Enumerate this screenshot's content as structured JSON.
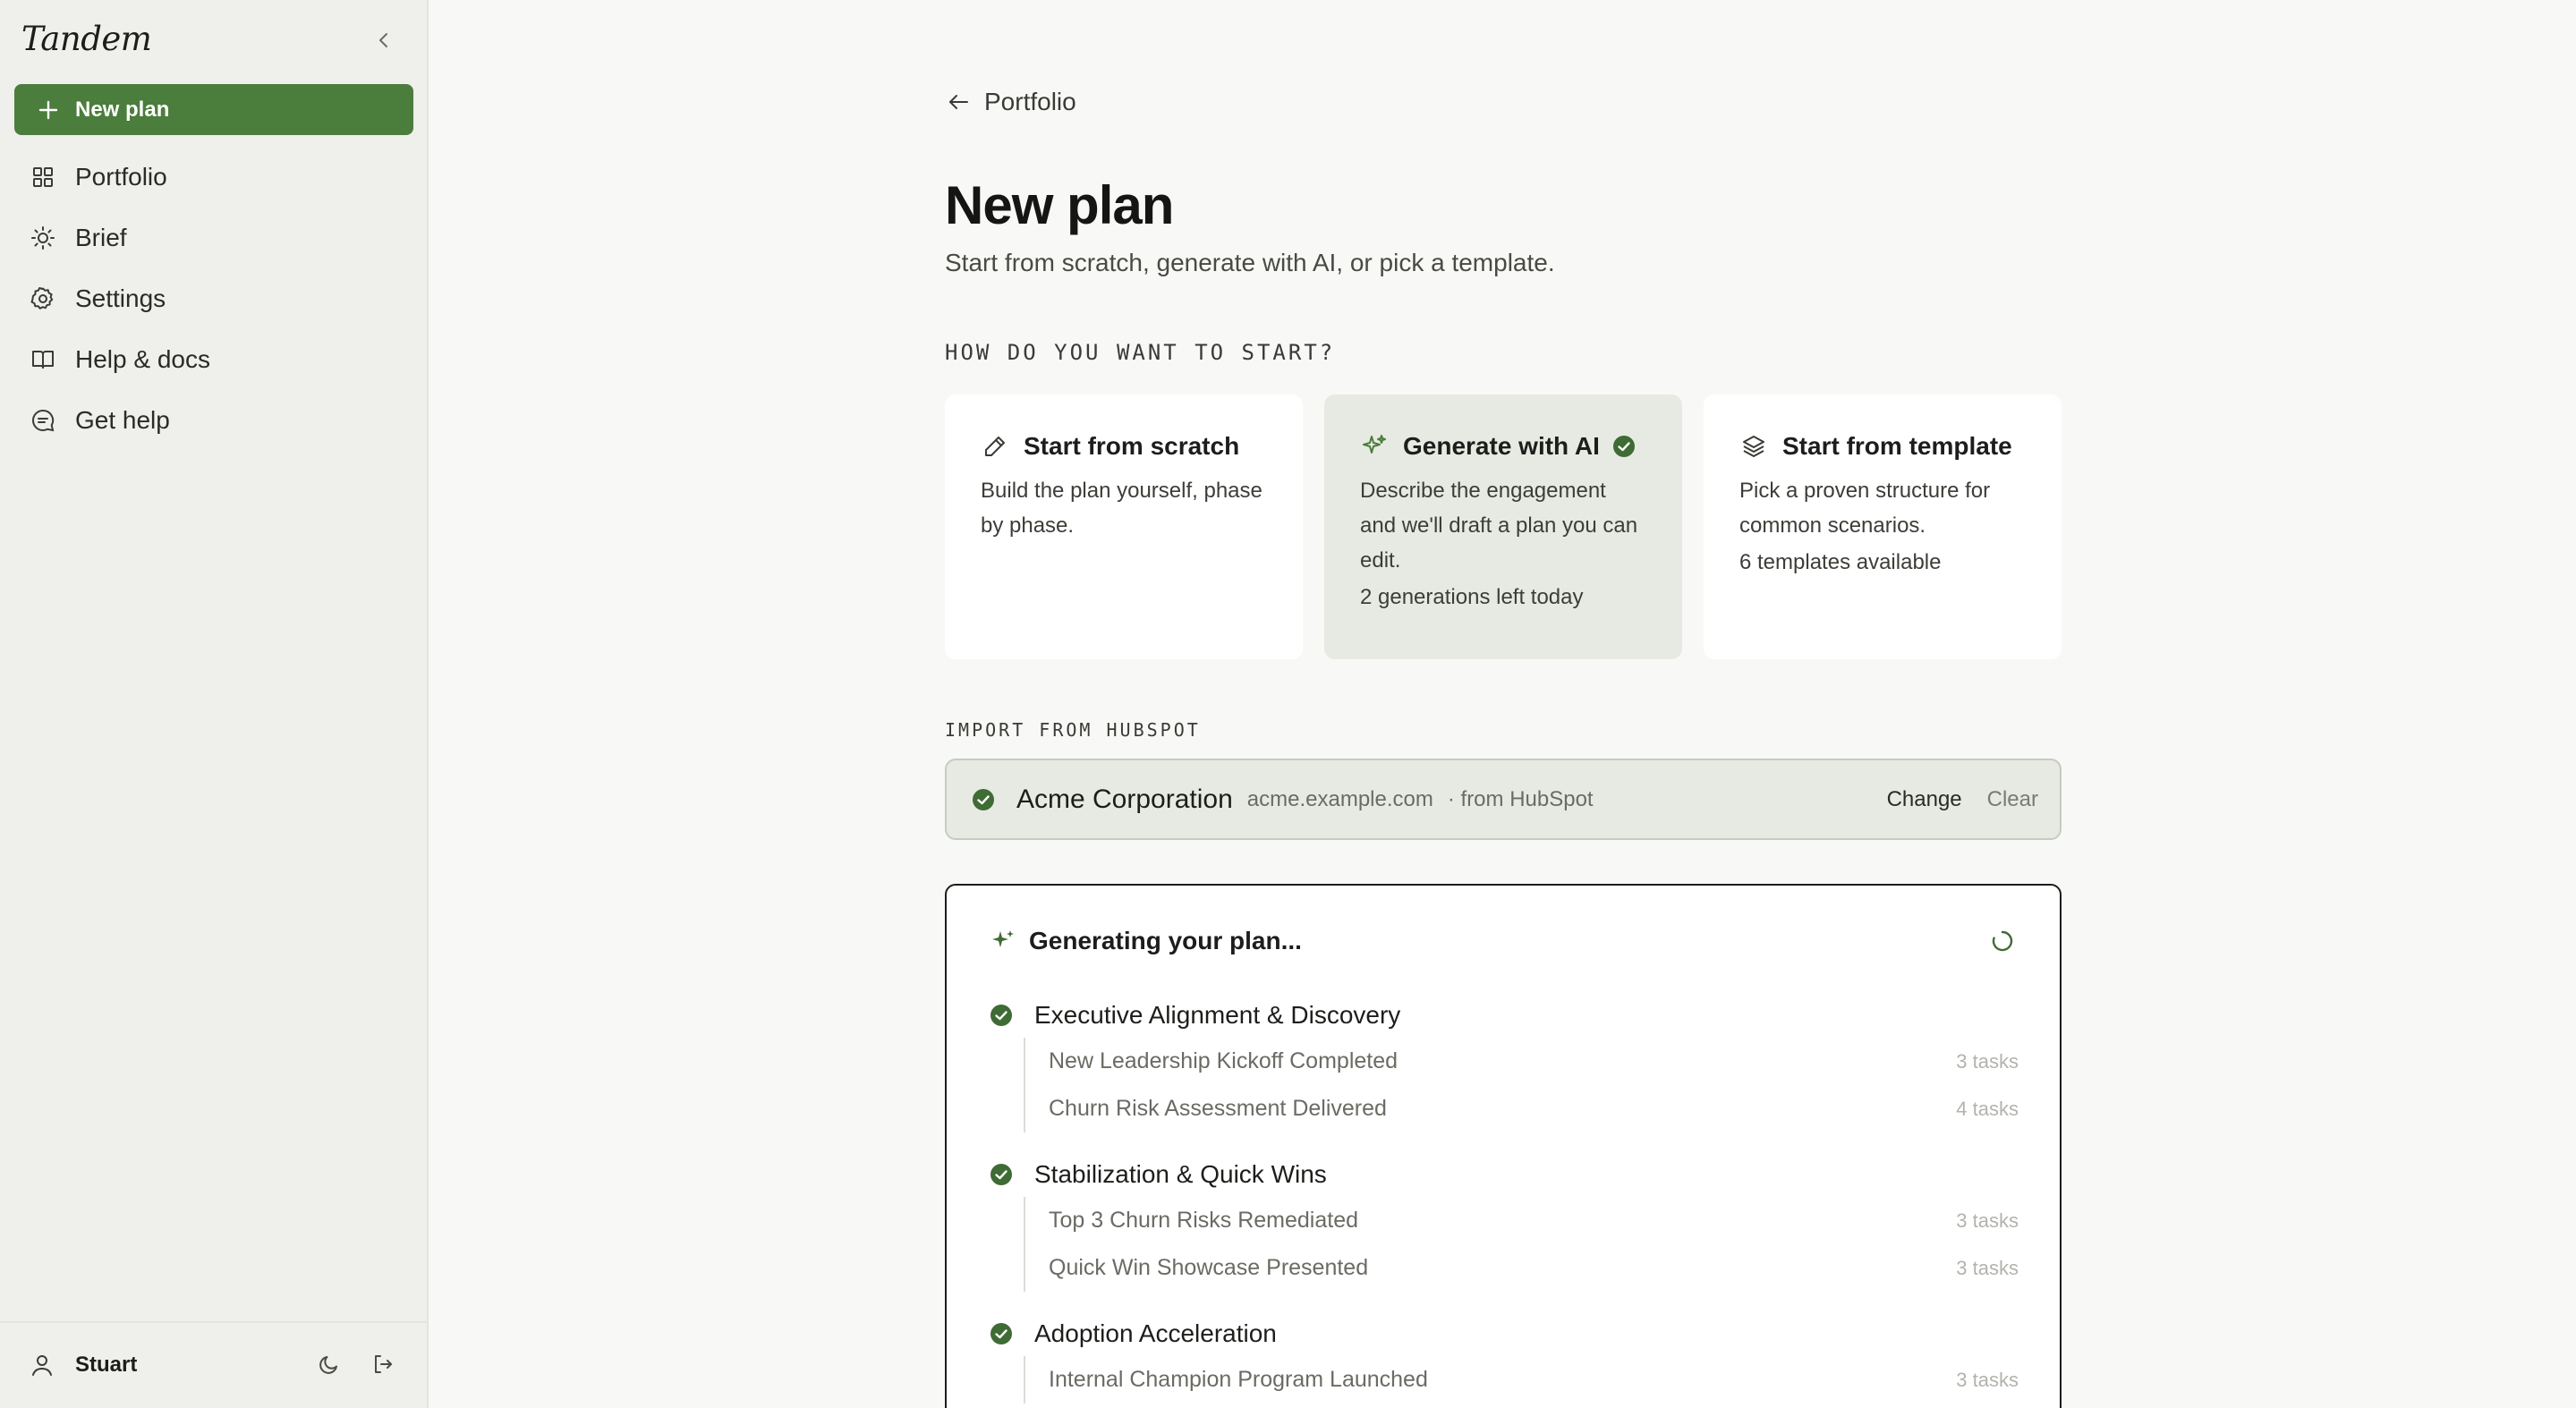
{
  "app": {
    "brand": "Tandem"
  },
  "sidebar": {
    "new_plan_label": "New plan",
    "items": [
      {
        "label": "Portfolio",
        "icon": "grid-icon"
      },
      {
        "label": "Brief",
        "icon": "sun-icon"
      },
      {
        "label": "Settings",
        "icon": "gear-icon"
      },
      {
        "label": "Help & docs",
        "icon": "book-icon"
      },
      {
        "label": "Get help",
        "icon": "chat-icon"
      }
    ],
    "user_name": "Stuart"
  },
  "main": {
    "back_label": "Portfolio",
    "title": "New plan",
    "subtitle": "Start from scratch, generate with AI, or pick a template.",
    "start_section_label": "HOW DO YOU WANT TO START?",
    "options": [
      {
        "title": "Start from scratch",
        "desc": "Build the plan yourself, phase by phase.",
        "meta": "",
        "icon": "pencil-icon",
        "selected": false
      },
      {
        "title": "Generate with AI",
        "desc": "Describe the engagement and we'll draft a plan you can edit.",
        "meta": "2 generations left today",
        "icon": "sparkle-icon",
        "selected": true
      },
      {
        "title": "Start from template",
        "desc": "Pick a proven structure for common scenarios.",
        "meta": "6 templates available",
        "icon": "layers-icon",
        "selected": false
      }
    ],
    "import_section_label": "IMPORT FROM HUBSPOT",
    "import": {
      "company": "Acme Corporation",
      "domain": "acme.example.com",
      "source": "· from HubSpot",
      "change_label": "Change",
      "clear_label": "Clear"
    },
    "generation": {
      "title": "Generating your plan...",
      "phases": [
        {
          "name": "Executive Alignment & Discovery",
          "milestones": [
            {
              "name": "New Leadership Kickoff Completed",
              "tasks": "3 tasks"
            },
            {
              "name": "Churn Risk Assessment Delivered",
              "tasks": "4 tasks"
            }
          ]
        },
        {
          "name": "Stabilization & Quick Wins",
          "milestones": [
            {
              "name": "Top 3 Churn Risks Remediated",
              "tasks": "3 tasks"
            },
            {
              "name": "Quick Win Showcase Presented",
              "tasks": "3 tasks"
            }
          ]
        },
        {
          "name": "Adoption Acceleration",
          "milestones": [
            {
              "name": "Internal Champion Program Launched",
              "tasks": "3 tasks"
            }
          ]
        }
      ]
    }
  },
  "colors": {
    "accent": "#4b7d3c",
    "check": "#3f6b34",
    "selected_bg": "#e7eae3"
  }
}
